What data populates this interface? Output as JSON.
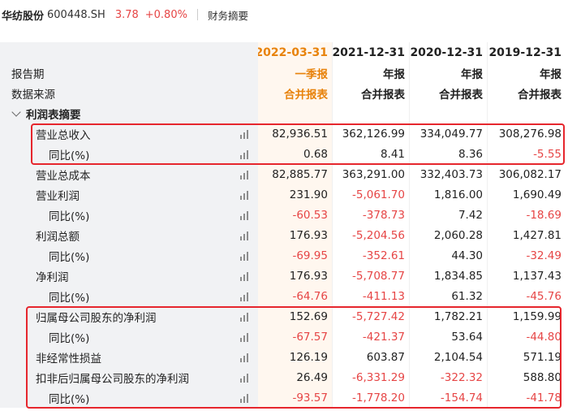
{
  "header": {
    "stock_name": "华纺股份",
    "stock_code": "600448.SH",
    "price": "3.78",
    "change": "+0.80%",
    "tab": "财务摘要"
  },
  "columns": [
    {
      "date": "2022-03-31",
      "period": "一季报",
      "source": "合并报表"
    },
    {
      "date": "2021-12-31",
      "period": "年报",
      "source": "合并报表"
    },
    {
      "date": "2020-12-31",
      "period": "年报",
      "source": "合并报表"
    },
    {
      "date": "2019-12-31",
      "period": "年报",
      "source": "合并报表"
    }
  ],
  "labels": {
    "report_period": "报告期",
    "data_source": "数据来源",
    "section": "利润表摘要"
  },
  "rows": [
    {
      "label": "营业总收入",
      "values": [
        "82,936.51",
        "362,126.99",
        "334,049.77",
        "308,276.98"
      ]
    },
    {
      "label": "同比(%)",
      "values": [
        "0.68",
        "8.41",
        "8.36",
        "-5.55"
      ]
    },
    {
      "label": "营业总成本",
      "values": [
        "82,885.77",
        "363,291.00",
        "332,403.73",
        "306,082.17"
      ]
    },
    {
      "label": "营业利润",
      "values": [
        "231.90",
        "-5,061.70",
        "1,816.00",
        "1,690.49"
      ]
    },
    {
      "label": "同比(%)",
      "values": [
        "-60.53",
        "-378.73",
        "7.42",
        "-18.69"
      ]
    },
    {
      "label": "利润总额",
      "values": [
        "176.93",
        "-5,204.56",
        "2,060.28",
        "1,427.81"
      ]
    },
    {
      "label": "同比(%)",
      "values": [
        "-69.95",
        "-352.61",
        "44.30",
        "-32.49"
      ]
    },
    {
      "label": "净利润",
      "values": [
        "176.93",
        "-5,708.77",
        "1,834.85",
        "1,137.43"
      ]
    },
    {
      "label": "同比(%)",
      "values": [
        "-64.76",
        "-411.13",
        "61.32",
        "-45.76"
      ]
    },
    {
      "label": "归属母公司股东的净利润",
      "values": [
        "152.69",
        "-5,727.42",
        "1,782.21",
        "1,159.99"
      ]
    },
    {
      "label": "同比(%)",
      "values": [
        "-67.57",
        "-421.37",
        "53.64",
        "-44.80"
      ]
    },
    {
      "label": "非经常性损益",
      "values": [
        "126.19",
        "603.87",
        "2,104.54",
        "571.19"
      ]
    },
    {
      "label": "扣非后归属母公司股东的净利润",
      "values": [
        "26.49",
        "-6,331.29",
        "-322.32",
        "588.80"
      ]
    },
    {
      "label": "同比(%)",
      "values": [
        "-93.57",
        "-1,778.20",
        "-154.74",
        "-41.78"
      ]
    }
  ],
  "colors": {
    "negative": "#e64545",
    "highlight_box": "#e6262d",
    "current_period": "#e8830c"
  }
}
